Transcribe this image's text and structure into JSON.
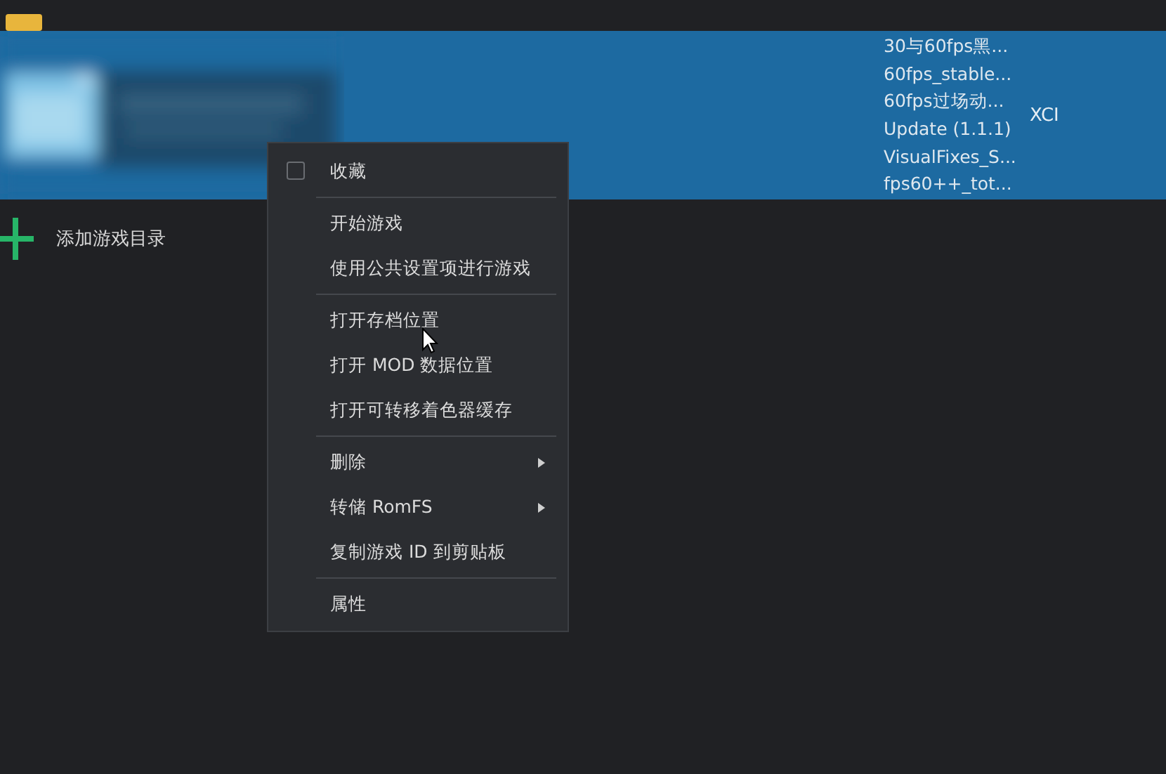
{
  "game_list": {
    "rows": [
      {
        "selected": true,
        "mods": [
          "30与60fps黑...",
          "60fps_stable...",
          "60fps过场动...",
          "Update (1.1.1)",
          "VisualFixes_S...",
          "fps60++_tot..."
        ],
        "file_type": "XCI"
      }
    ]
  },
  "add_directory": {
    "label": "添加游戏目录"
  },
  "context_menu": {
    "items": [
      {
        "kind": "check",
        "label": "收藏",
        "checked": false
      },
      {
        "kind": "separator"
      },
      {
        "kind": "action",
        "label": "开始游戏"
      },
      {
        "kind": "action",
        "label": "使用公共设置项进行游戏"
      },
      {
        "kind": "separator"
      },
      {
        "kind": "action",
        "label": "打开存档位置"
      },
      {
        "kind": "action",
        "label": "打开 MOD 数据位置"
      },
      {
        "kind": "action",
        "label": "打开可转移着色器缓存"
      },
      {
        "kind": "separator"
      },
      {
        "kind": "submenu",
        "label": "删除"
      },
      {
        "kind": "submenu",
        "label": "转储 RomFS"
      },
      {
        "kind": "action",
        "label": "复制游戏 ID 到剪贴板"
      },
      {
        "kind": "separator"
      },
      {
        "kind": "action",
        "label": "属性"
      }
    ]
  }
}
